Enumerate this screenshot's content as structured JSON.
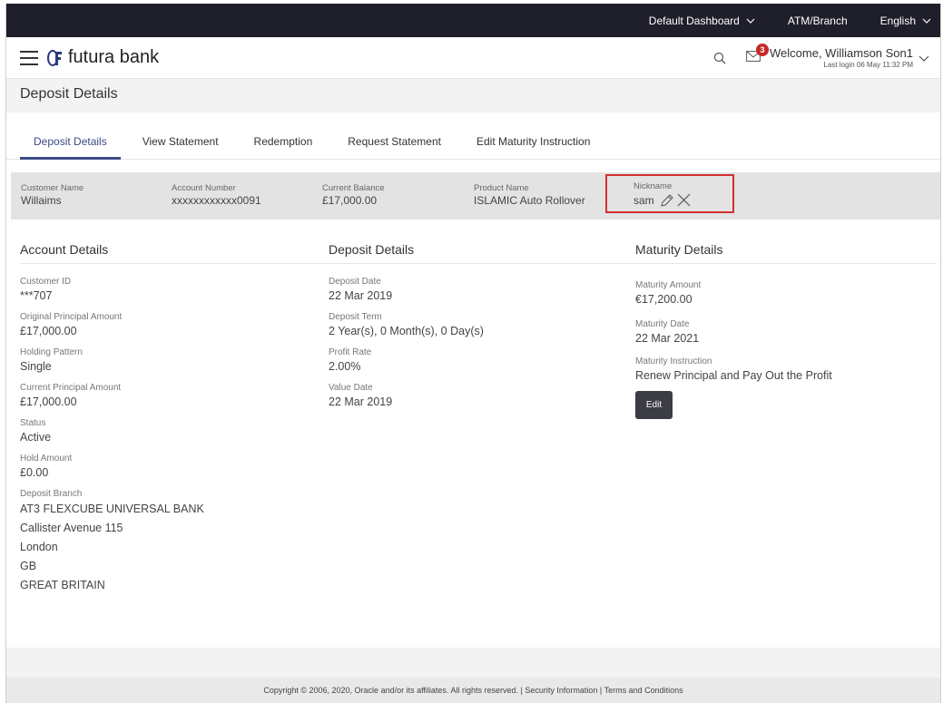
{
  "topbar": {
    "dashboard": "Default Dashboard",
    "atm": "ATM/Branch",
    "language": "English"
  },
  "header": {
    "brand": "futura bank",
    "notification_count": "3",
    "welcome": "Welcome, Williamson Son1",
    "last_login": "Last login 06 May 11:32 PM"
  },
  "page_title": "Deposit Details",
  "tabs": [
    {
      "label": "Deposit Details",
      "active": true
    },
    {
      "label": "View Statement"
    },
    {
      "label": "Redemption"
    },
    {
      "label": "Request Statement"
    },
    {
      "label": "Edit Maturity Instruction"
    }
  ],
  "summary": {
    "customer_name": {
      "label": "Customer Name",
      "value": "Willaims"
    },
    "account_number": {
      "label": "Account Number",
      "value": "xxxxxxxxxxxx0091"
    },
    "current_balance": {
      "label": "Current Balance",
      "value": "£17,000.00"
    },
    "product_name": {
      "label": "Product Name",
      "value": "ISLAMIC Auto Rollover"
    },
    "nickname": {
      "label": "Nickname",
      "value": "sam"
    }
  },
  "account_details": {
    "title": "Account Details",
    "fields": [
      {
        "label": "Customer ID",
        "value": "***707"
      },
      {
        "label": "Original Principal Amount",
        "value": "£17,000.00"
      },
      {
        "label": "Holding Pattern",
        "value": "Single"
      },
      {
        "label": "Current Principal Amount",
        "value": "£17,000.00"
      },
      {
        "label": "Status",
        "value": "Active"
      },
      {
        "label": "Hold Amount",
        "value": "£0.00"
      }
    ],
    "branch_label": "Deposit Branch",
    "branch_lines": [
      "AT3 FLEXCUBE UNIVERSAL BANK",
      "Callister Avenue 115",
      "London",
      "GB",
      "GREAT BRITAIN"
    ]
  },
  "deposit_details": {
    "title": "Deposit Details",
    "fields": [
      {
        "label": "Deposit Date",
        "value": "22 Mar 2019"
      },
      {
        "label": "Deposit Term",
        "value": "2 Year(s), 0 Month(s), 0 Day(s)"
      },
      {
        "label": "Profit Rate",
        "value": "2.00%"
      },
      {
        "label": "Value Date",
        "value": "22 Mar 2019"
      }
    ]
  },
  "maturity_details": {
    "title": "Maturity Details",
    "fields": [
      {
        "label": "Maturity Amount",
        "value": "€17,200.00"
      },
      {
        "label": "Maturity Date",
        "value": "22 Mar 2021"
      },
      {
        "label": "Maturity Instruction",
        "value": "Renew Principal and Pay Out the Profit"
      }
    ],
    "edit_label": "Edit"
  },
  "footer": {
    "copyright": "Copyright © 2006, 2020, Oracle and/or its affiliates. All rights reserved. |",
    "security": "Security Information",
    "separator": "|",
    "terms": "Terms and Conditions"
  }
}
